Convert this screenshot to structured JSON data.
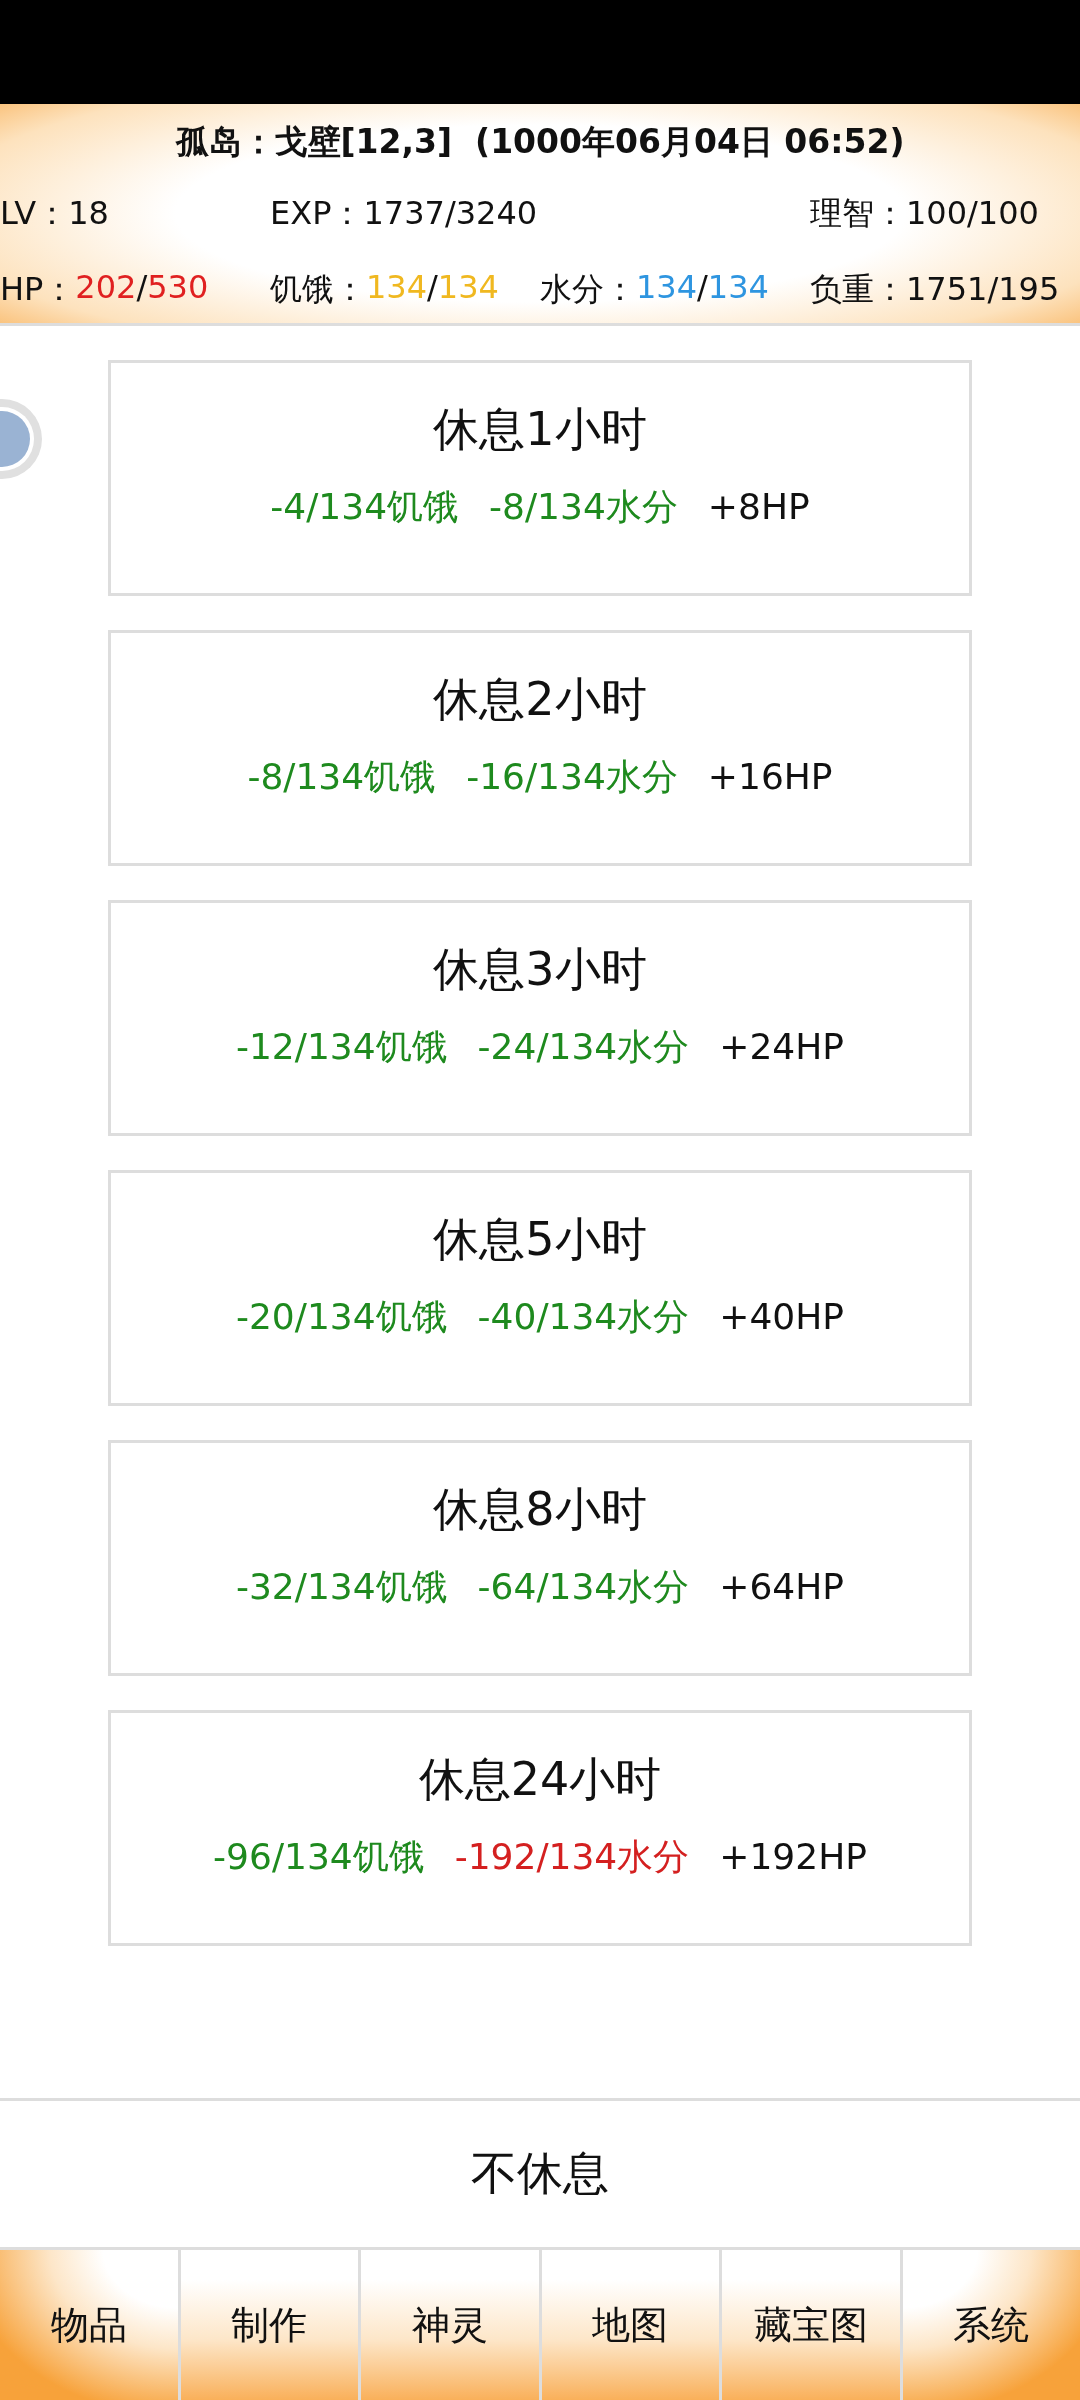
{
  "header": {
    "title": "孤岛：戈壁[12,3]  (1000年06月04日 06:52)",
    "stat_rows": [
      [
        {
          "label": "LV：",
          "value": "18"
        },
        {
          "label": "EXP：",
          "value": "1737/3240"
        },
        {
          "label": "理智：",
          "value": "100/100"
        }
      ],
      [
        {
          "label": "HP：",
          "current": "202",
          "divider": "/",
          "max": "530",
          "color": "#e02020"
        },
        {
          "label": "饥饿：",
          "current": "134",
          "divider": "/",
          "max": "134",
          "color": "#f0b820"
        },
        {
          "label": "水分：",
          "current": "134",
          "divider": "/",
          "max": "134",
          "color": "#2e95e0"
        },
        {
          "label": "负重：",
          "value": "1751/195"
        }
      ]
    ]
  },
  "rest_options": [
    {
      "title": "休息1小时",
      "effects": [
        {
          "text": "-4/134饥饿",
          "color": "#1e8a1e"
        },
        {
          "text": "-8/134水分",
          "color": "#1e8a1e"
        },
        {
          "text": "+8HP",
          "color": "#111111"
        }
      ]
    },
    {
      "title": "休息2小时",
      "effects": [
        {
          "text": "-8/134饥饿",
          "color": "#1e8a1e"
        },
        {
          "text": "-16/134水分",
          "color": "#1e8a1e"
        },
        {
          "text": "+16HP",
          "color": "#111111"
        }
      ]
    },
    {
      "title": "休息3小时",
      "effects": [
        {
          "text": "-12/134饥饿",
          "color": "#1e8a1e"
        },
        {
          "text": "-24/134水分",
          "color": "#1e8a1e"
        },
        {
          "text": "+24HP",
          "color": "#111111"
        }
      ]
    },
    {
      "title": "休息5小时",
      "effects": [
        {
          "text": "-20/134饥饿",
          "color": "#1e8a1e"
        },
        {
          "text": "-40/134水分",
          "color": "#1e8a1e"
        },
        {
          "text": "+40HP",
          "color": "#111111"
        }
      ]
    },
    {
      "title": "休息8小时",
      "effects": [
        {
          "text": "-32/134饥饿",
          "color": "#1e8a1e"
        },
        {
          "text": "-64/134水分",
          "color": "#1e8a1e"
        },
        {
          "text": "+64HP",
          "color": "#111111"
        }
      ]
    },
    {
      "title": "休息24小时",
      "effects": [
        {
          "text": "-96/134饥饿",
          "color": "#1e8a1e"
        },
        {
          "text": "-192/134水分",
          "color": "#d42020"
        },
        {
          "text": "+192HP",
          "color": "#111111"
        }
      ]
    }
  ],
  "no_rest_button": "不休息",
  "nav": [
    "物品",
    "制作",
    "神灵",
    "地图",
    "藏宝图",
    "系统"
  ]
}
